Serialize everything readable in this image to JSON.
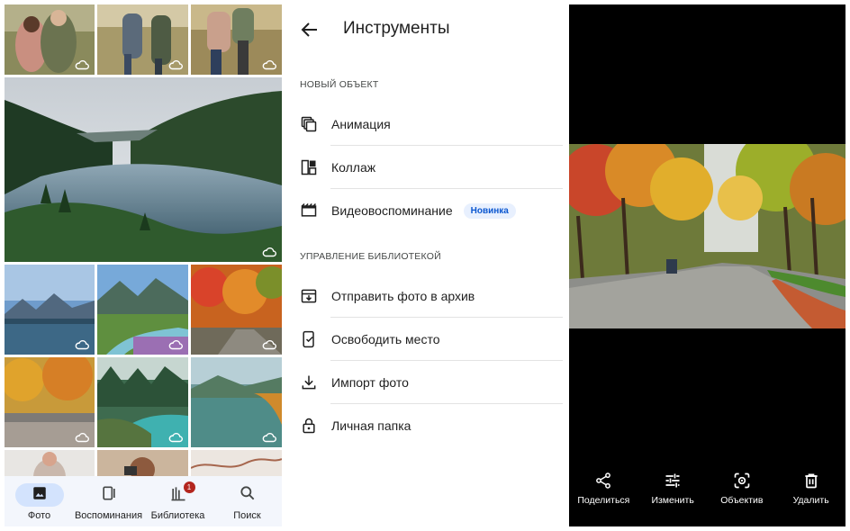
{
  "gallery": {
    "nav": [
      {
        "label": "Фото",
        "icon": "photo-icon",
        "active": true
      },
      {
        "label": "Воспоминания",
        "icon": "memories-icon",
        "active": false
      },
      {
        "label": "Библиотека",
        "icon": "library-icon",
        "active": false,
        "badge": "1"
      },
      {
        "label": "Поиск",
        "icon": "search-icon",
        "active": false
      }
    ]
  },
  "tools": {
    "title": "Инструменты",
    "section_new": "НОВЫЙ ОБЪЕКТ",
    "items_new": [
      {
        "label": "Анимация",
        "icon": "animation-icon"
      },
      {
        "label": "Коллаж",
        "icon": "collage-icon"
      },
      {
        "label": "Видеовоспоминание",
        "icon": "movie-icon",
        "chip": "Новинка"
      }
    ],
    "section_library": "УПРАВЛЕНИЕ БИБЛИОТЕКОЙ",
    "items_library": [
      {
        "label": "Отправить фото в архив",
        "icon": "archive-icon"
      },
      {
        "label": "Освободить место",
        "icon": "free-space-icon"
      },
      {
        "label": "Импорт фото",
        "icon": "download-icon"
      },
      {
        "label": "Личная папка",
        "icon": "lock-icon"
      }
    ]
  },
  "viewer": {
    "actions": [
      {
        "label": "Поделиться",
        "icon": "share-icon"
      },
      {
        "label": "Изменить",
        "icon": "edit-sliders-icon"
      },
      {
        "label": "Объектив",
        "icon": "lens-icon"
      },
      {
        "label": "Удалить",
        "icon": "delete-icon"
      }
    ]
  },
  "colors": {
    "accent": "#0b57d0",
    "active_nav_bg": "#d3e3fd",
    "nav_bg": "#f3f6fc",
    "badge": "#b3261e",
    "viewer_bg": "#000000"
  }
}
